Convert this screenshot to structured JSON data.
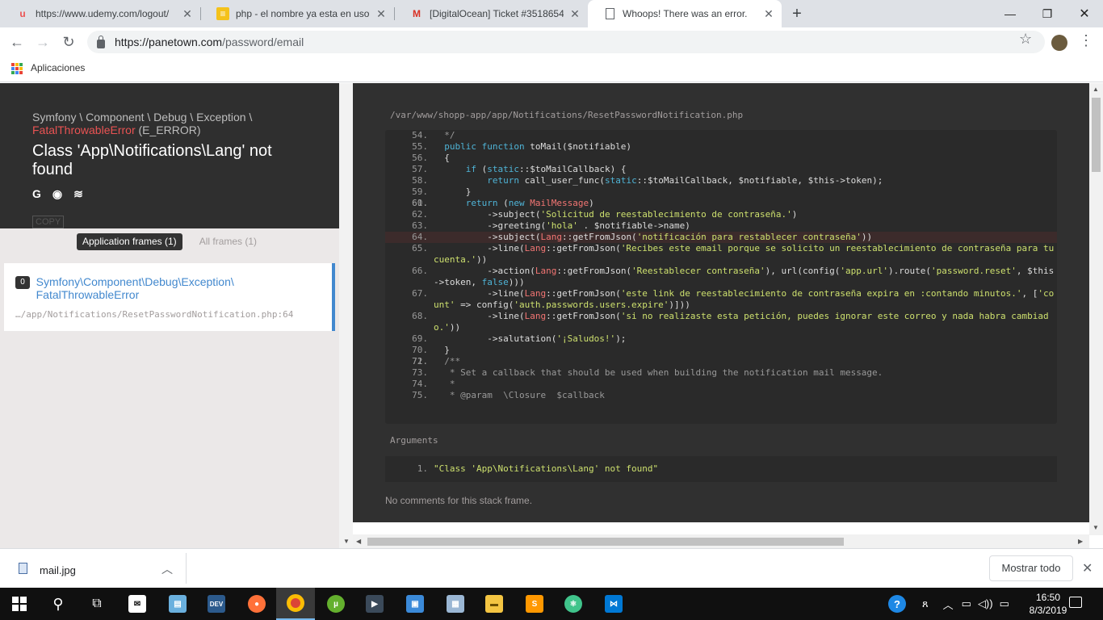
{
  "browser": {
    "tabs": [
      {
        "title": "https://www.udemy.com/logout/",
        "icon": "udemy-icon"
      },
      {
        "title": "php - el nombre ya esta en uso?",
        "icon": "stackoverflow-icon"
      },
      {
        "title": "[DigitalOcean] Ticket #3518654:",
        "icon": "gmail-icon"
      },
      {
        "title": "Whoops! There was an error.",
        "icon": "document-icon"
      }
    ],
    "new_tab": "+",
    "url_host": "https://panetown.com",
    "url_path": "/password/email",
    "bookmarks_label": "Aplicaciones"
  },
  "exception": {
    "namespace": "Symfony \\ Component \\ Debug \\ Exception \\",
    "class": "FatalThrowableError",
    "type": "(E_ERROR)",
    "message": "Class 'App\\Notifications\\Lang' not found",
    "icons": [
      "google-icon",
      "duckduckgo-icon",
      "stackoverflow-icon"
    ],
    "copy_label": "COPY"
  },
  "frames_tabs": {
    "app": "Application frames (1)",
    "all": "All frames (1)"
  },
  "frame": {
    "index": "0",
    "class_line1": "Symfony\\Component\\Debug\\Exception\\",
    "class_line2": "FatalThrowableError",
    "file": "…/app/Notifications/ResetPasswordNotification.php:64"
  },
  "code_panel": {
    "file_path": "/var/www/shopp-app/app/Notifications/ResetPasswordNotification.php",
    "highlight_line": "64",
    "lines": [
      {
        "n": "54.",
        "parts": [
          [
            "cm",
            "  */"
          ]
        ]
      },
      {
        "n": "55.",
        "parts": [
          [
            "",
            "  "
          ],
          [
            "kw",
            "public function"
          ],
          [
            "",
            " toMail($notifiable)"
          ]
        ]
      },
      {
        "n": "56.",
        "parts": [
          [
            "",
            "  {"
          ]
        ]
      },
      {
        "n": "57.",
        "parts": [
          [
            "",
            "      "
          ],
          [
            "kw",
            "if"
          ],
          [
            "",
            " ("
          ],
          [
            "kw",
            "static"
          ],
          [
            "",
            "::$toMailCallback) {"
          ]
        ]
      },
      {
        "n": "58.",
        "parts": [
          [
            "",
            "          "
          ],
          [
            "kw",
            "return"
          ],
          [
            "",
            " call_user_func("
          ],
          [
            "kw",
            "static"
          ],
          [
            "",
            "::$toMailCallback, $notifiable, $this->token);"
          ]
        ]
      },
      {
        "n": "59.",
        "parts": [
          [
            "",
            "      }"
          ]
        ]
      },
      {
        "n": "60.",
        "parts": [
          [
            "",
            ""
          ]
        ]
      },
      {
        "n": "61.",
        "parts": [
          [
            "",
            "      "
          ],
          [
            "kw",
            "return"
          ],
          [
            "",
            " ("
          ],
          [
            "kw",
            "new"
          ],
          [
            "",
            " "
          ],
          [
            "cls",
            "MailMessage"
          ],
          [
            "",
            ")"
          ]
        ]
      },
      {
        "n": "62.",
        "parts": [
          [
            "",
            "          ->subject("
          ],
          [
            "str",
            "'Solicitud de reestablecimiento de contraseña.'"
          ],
          [
            "",
            ")"
          ]
        ]
      },
      {
        "n": "63.",
        "parts": [
          [
            "",
            "          ->greeting("
          ],
          [
            "str",
            "'hola'"
          ],
          [
            "",
            " . $notifiable->name)"
          ]
        ]
      },
      {
        "n": "64.",
        "parts": [
          [
            "",
            "          ->subject("
          ],
          [
            "cls",
            "Lang"
          ],
          [
            "",
            "::getFromJson("
          ],
          [
            "str",
            "'notificación para restablecer contraseña'"
          ],
          [
            "",
            "))"
          ]
        ]
      },
      {
        "n": "65.",
        "parts": [
          [
            "",
            "          ->line("
          ],
          [
            "cls",
            "Lang"
          ],
          [
            "",
            "::getFromJson("
          ],
          [
            "str",
            "'Recibes este email porque se solicito un reestablecimiento de contraseña para tu cuenta.'"
          ],
          [
            "",
            "))"
          ]
        ]
      },
      {
        "n": "66.",
        "parts": [
          [
            "",
            "          ->action("
          ],
          [
            "cls",
            "Lang"
          ],
          [
            "",
            "::getFromJson("
          ],
          [
            "str",
            "'Reestablecer contraseña'"
          ],
          [
            "",
            "), url(config("
          ],
          [
            "str",
            "'app.url'"
          ],
          [
            "",
            ").route("
          ],
          [
            "str",
            "'password.reset'"
          ],
          [
            "",
            ", $this->token, "
          ],
          [
            "kw",
            "false"
          ],
          [
            "",
            ")))"
          ]
        ]
      },
      {
        "n": "67.",
        "parts": [
          [
            "",
            "          ->line("
          ],
          [
            "cls",
            "Lang"
          ],
          [
            "",
            "::getFromJson("
          ],
          [
            "str",
            "'este link de reestablecimiento de contraseña expira en :contando minutos.'"
          ],
          [
            "",
            ", ["
          ],
          [
            "str",
            "'count'"
          ],
          [
            "",
            " => config("
          ],
          [
            "str",
            "'auth.passwords.users.expire'"
          ],
          [
            "",
            ")]))"
          ]
        ]
      },
      {
        "n": "68.",
        "parts": [
          [
            "",
            "          ->line("
          ],
          [
            "cls",
            "Lang"
          ],
          [
            "",
            "::getFromJson("
          ],
          [
            "str",
            "'si no realizaste esta petición, puedes ignorar este correo y nada habra cambiado.'"
          ],
          [
            "",
            "))"
          ]
        ]
      },
      {
        "n": "69.",
        "parts": [
          [
            "",
            "          ->salutation("
          ],
          [
            "str",
            "'¡Saludos!'"
          ],
          [
            "",
            ");"
          ]
        ]
      },
      {
        "n": "70.",
        "parts": [
          [
            "",
            "  }"
          ]
        ]
      },
      {
        "n": "71.",
        "parts": [
          [
            "",
            ""
          ]
        ]
      },
      {
        "n": "72.",
        "parts": [
          [
            "cm",
            "  /**"
          ]
        ]
      },
      {
        "n": "73.",
        "parts": [
          [
            "cm",
            "   * Set a callback that should be used when building the notification mail message."
          ]
        ]
      },
      {
        "n": "74.",
        "parts": [
          [
            "cm",
            "   *"
          ]
        ]
      },
      {
        "n": "75.",
        "parts": [
          [
            "cm",
            "   * @param  \\Closure  $callback"
          ]
        ]
      }
    ],
    "arguments_label": "Arguments",
    "argument_index": "1.",
    "argument_value": "\"Class 'App\\Notifications\\Lang' not found\"",
    "comments": "No comments for this stack frame."
  },
  "download_bar": {
    "file": "mail.jpg",
    "show_all": "Mostrar todo"
  },
  "taskbar": {
    "time": "16:50",
    "date": "8/3/2019"
  }
}
